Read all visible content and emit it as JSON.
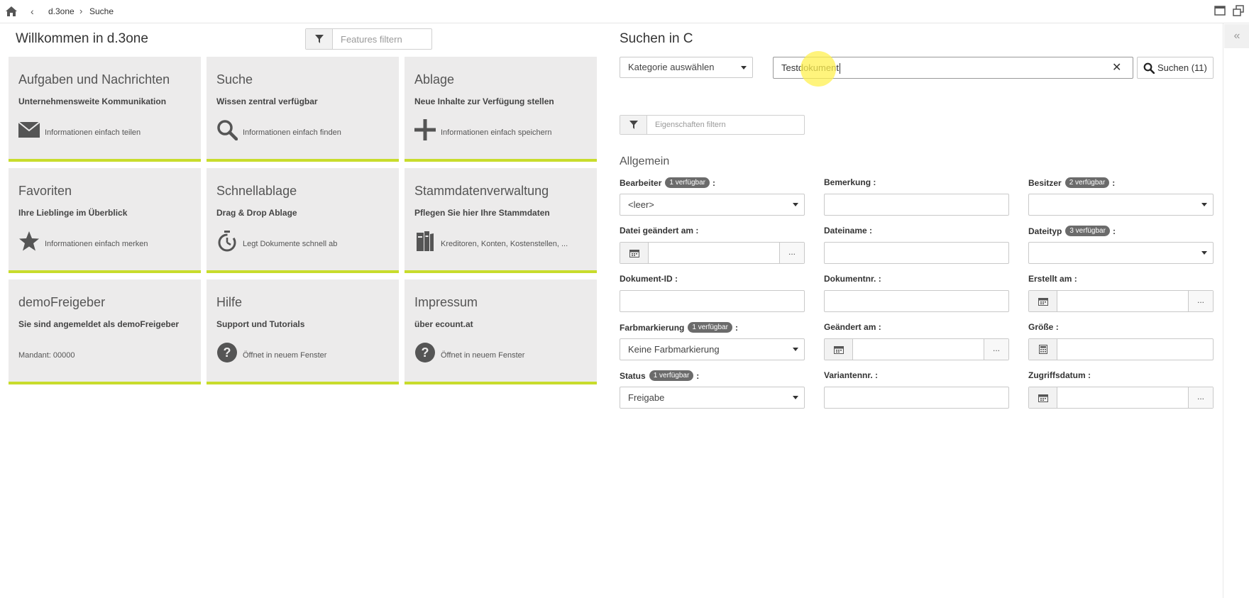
{
  "topbar": {
    "breadcrumbs": [
      "d.3one",
      "Suche"
    ],
    "breadcrumb_separator": "›"
  },
  "left": {
    "title": "Willkommen in d.3one",
    "filter_placeholder": "Features filtern",
    "tiles": [
      {
        "title": "Aufgaben und Nachrichten",
        "subtitle": "Unternehmensweite Kommunikation",
        "footer": "Informationen einfach teilen",
        "icon": "envelope-icon"
      },
      {
        "title": "Suche",
        "subtitle": "Wissen zentral verfügbar",
        "footer": "Informationen einfach finden",
        "icon": "search-icon"
      },
      {
        "title": "Ablage",
        "subtitle": "Neue Inhalte zur Verfügung stellen",
        "footer": "Informationen einfach speichern",
        "icon": "plus-icon"
      },
      {
        "title": "Favoriten",
        "subtitle": "Ihre Lieblinge im Überblick",
        "footer": "Informationen einfach merken",
        "icon": "star-icon"
      },
      {
        "title": "Schnellablage",
        "subtitle": "Drag & Drop Ablage",
        "footer": "Legt Dokumente schnell ab",
        "icon": "stopwatch-icon"
      },
      {
        "title": "Stammdatenverwaltung",
        "subtitle": "Pflegen Sie hier Ihre Stammdaten",
        "footer": "Kreditoren, Konten, Kostenstellen, ...",
        "icon": "binder-icon"
      },
      {
        "title": "demoFreigeber",
        "subtitle": "Sie sind angemeldet als demoFreigeber",
        "footer": "Mandant: 00000",
        "icon": ""
      },
      {
        "title": "Hilfe",
        "subtitle": "Support und Tutorials",
        "footer": "Öffnet in neuem Fenster",
        "icon": "question-icon"
      },
      {
        "title": "Impressum",
        "subtitle": "über ecount.at",
        "footer": "Öffnet in neuem Fenster",
        "icon": "question-icon"
      }
    ]
  },
  "right": {
    "title": "Suchen in C",
    "category_select": "Kategorie auswählen",
    "search_value": "Testdokument",
    "search_button": "Suchen (11)",
    "properties_filter_placeholder": "Eigenschaften filtern",
    "section": "Allgemein",
    "fields": [
      {
        "label": "Bearbeiter",
        "badge": "1 verfügbar",
        "type": "select",
        "value": "<leer>"
      },
      {
        "label": "Bemerkung",
        "badge": "",
        "type": "text",
        "value": ""
      },
      {
        "label": "Besitzer",
        "badge": "2 verfügbar",
        "type": "select",
        "value": ""
      },
      {
        "label": "Datei geändert am",
        "badge": "",
        "type": "date",
        "value": ""
      },
      {
        "label": "Dateiname",
        "badge": "",
        "type": "text",
        "value": ""
      },
      {
        "label": "Dateityp",
        "badge": "3 verfügbar",
        "type": "select",
        "value": ""
      },
      {
        "label": "Dokument-ID",
        "badge": "",
        "type": "text",
        "value": ""
      },
      {
        "label": "Dokumentnr.",
        "badge": "",
        "type": "text",
        "value": ""
      },
      {
        "label": "Erstellt am",
        "badge": "",
        "type": "date",
        "value": ""
      },
      {
        "label": "Farbmarkierung",
        "badge": "1 verfügbar",
        "type": "select",
        "value": "Keine Farbmarkierung"
      },
      {
        "label": "Geändert am",
        "badge": "",
        "type": "date",
        "value": ""
      },
      {
        "label": "Größe",
        "badge": "",
        "type": "number",
        "value": ""
      },
      {
        "label": "Status",
        "badge": "1 verfügbar",
        "type": "select",
        "value": "Freigabe"
      },
      {
        "label": "Variantennr.",
        "badge": "",
        "type": "text",
        "value": ""
      },
      {
        "label": "Zugriffsdatum",
        "badge": "",
        "type": "date",
        "value": ""
      }
    ],
    "label_suffix": ":",
    "date_more": "..."
  },
  "colors": {
    "tile_background": "#ecebeb",
    "tile_accent": "#c8dc2c",
    "badge": "#6b6b6b",
    "cursor_highlight": "#fff050"
  }
}
